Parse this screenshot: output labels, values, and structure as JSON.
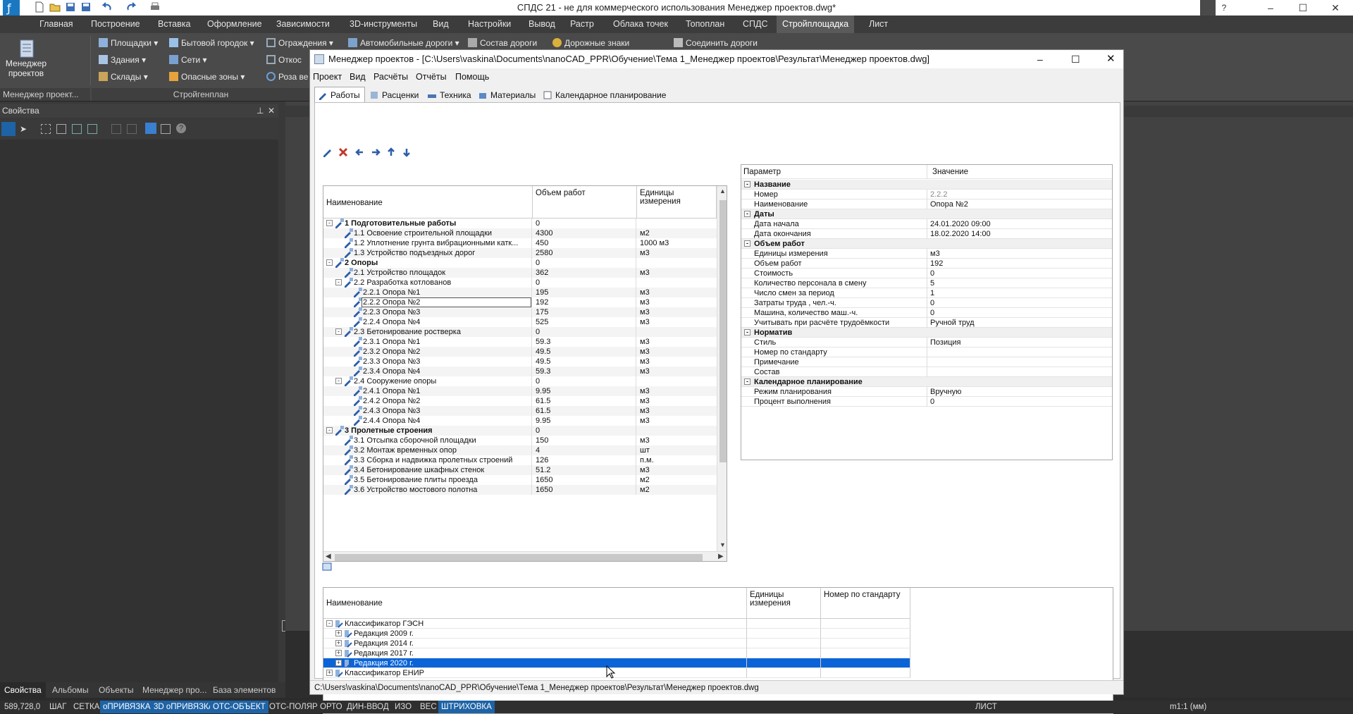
{
  "app": {
    "title": "СПДС 21 - не для коммерческого использования Менеджер проектов.dwg*"
  },
  "menu_tabs": [
    "Главная",
    "Построение",
    "Вставка",
    "Оформление",
    "Зависимости",
    "3D-инструменты",
    "Вид",
    "Настройки",
    "Вывод",
    "Растр",
    "Облака точек",
    "Топоплан",
    "СПДС",
    "Стройплощадка",
    "Лист"
  ],
  "ribbon": {
    "big_button": [
      "Менеджер",
      "проектов"
    ],
    "items": [
      "Площадки",
      "Бытовой городок",
      "Ограждения",
      "Автомобильные дороги",
      "Состав дороги",
      "Дорожные знаки",
      "Соединить дороги",
      "Здания",
      "Сети",
      "Откос",
      "Склады",
      "Опасные зоны",
      "Роза ве"
    ],
    "group_labels": [
      "Менеджер проект...",
      "Стройгенплан"
    ]
  },
  "left_panel": {
    "title": "Свойства",
    "bottom_tabs": [
      "Свойства",
      "Альбомы",
      "Объекты",
      "Менеджер про...",
      "База элементов"
    ]
  },
  "dialog": {
    "title": "Менеджер проектов - [C:\\Users\\vaskina\\Documents\\nanoCAD_PPR\\Обучение\\Тема 1_Менеджер проектов\\Результат\\Менеджер проектов.dwg]",
    "menu": [
      "Проект",
      "Вид",
      "Расчёты",
      "Отчёты",
      "Помощь"
    ],
    "tabs": [
      "Работы",
      "Расценки",
      "Техника",
      "Материалы",
      "Календарное планирование"
    ],
    "works_columns": [
      "Наименование",
      "Объем работ",
      "Единицы измерения"
    ],
    "works": [
      {
        "level": 0,
        "exp": "-",
        "name": "1 Подготовительные работы",
        "qty": "0",
        "unit": "",
        "bold": true
      },
      {
        "level": 1,
        "exp": "",
        "name": "1.1 Освоение строительной площадки",
        "qty": "4300",
        "unit": "м2"
      },
      {
        "level": 1,
        "exp": "",
        "name": "1.2 Уплотнение грунта вибрационными катк...",
        "qty": "450",
        "unit": "1000 м3"
      },
      {
        "level": 1,
        "exp": "",
        "name": "1.3 Устройство подъездных дорог",
        "qty": "2580",
        "unit": "м3"
      },
      {
        "level": 0,
        "exp": "-",
        "name": "2 Опоры",
        "qty": "0",
        "unit": "",
        "bold": true
      },
      {
        "level": 1,
        "exp": "",
        "name": "2.1 Устройство площадок",
        "qty": "362",
        "unit": "м3"
      },
      {
        "level": 1,
        "exp": "-",
        "name": "2.2 Разработка котлованов",
        "qty": "0",
        "unit": ""
      },
      {
        "level": 2,
        "exp": "",
        "name": "2.2.1 Опора №1",
        "qty": "195",
        "unit": "м3"
      },
      {
        "level": 2,
        "exp": "",
        "name": "2.2.2 Опора №2",
        "qty": "192",
        "unit": "м3",
        "selected": true
      },
      {
        "level": 2,
        "exp": "",
        "name": "2.2.3 Опора №3",
        "qty": "175",
        "unit": "м3"
      },
      {
        "level": 2,
        "exp": "",
        "name": "2.2.4 Опора №4",
        "qty": "525",
        "unit": "м3"
      },
      {
        "level": 1,
        "exp": "-",
        "name": "2.3 Бетонирование ростверка",
        "qty": "0",
        "unit": ""
      },
      {
        "level": 2,
        "exp": "",
        "name": "2.3.1 Опора №1",
        "qty": "59.3",
        "unit": "м3"
      },
      {
        "level": 2,
        "exp": "",
        "name": "2.3.2 Опора №2",
        "qty": "49.5",
        "unit": "м3"
      },
      {
        "level": 2,
        "exp": "",
        "name": "2.3.3 Опора №3",
        "qty": "49.5",
        "unit": "м3"
      },
      {
        "level": 2,
        "exp": "",
        "name": "2.3.4 Опора №4",
        "qty": "59.3",
        "unit": "м3"
      },
      {
        "level": 1,
        "exp": "-",
        "name": "2.4 Сооружение опоры",
        "qty": "0",
        "unit": ""
      },
      {
        "level": 2,
        "exp": "",
        "name": "2.4.1 Опора №1",
        "qty": "9.95",
        "unit": "м3"
      },
      {
        "level": 2,
        "exp": "",
        "name": "2.4.2 Опора №2",
        "qty": "61.5",
        "unit": "м3"
      },
      {
        "level": 2,
        "exp": "",
        "name": "2.4.3 Опора №3",
        "qty": "61.5",
        "unit": "м3"
      },
      {
        "level": 2,
        "exp": "",
        "name": "2.4.4 Опора №4",
        "qty": "9.95",
        "unit": "м3"
      },
      {
        "level": 0,
        "exp": "-",
        "name": "3 Пролетные строения",
        "qty": "0",
        "unit": "",
        "bold": true
      },
      {
        "level": 1,
        "exp": "",
        "name": "3.1 Отсыпка сборочной площадки",
        "qty": "150",
        "unit": "м3"
      },
      {
        "level": 1,
        "exp": "",
        "name": "3.2 Монтаж временных опор",
        "qty": "4",
        "unit": "шт"
      },
      {
        "level": 1,
        "exp": "",
        "name": "3.3 Сборка и надвижка пролетных строений",
        "qty": "126",
        "unit": "п.м."
      },
      {
        "level": 1,
        "exp": "",
        "name": "3.4 Бетонирование шкафных стенок",
        "qty": "51.2",
        "unit": "м3"
      },
      {
        "level": 1,
        "exp": "",
        "name": "3.5 Бетонирование плиты проезда",
        "qty": "1650",
        "unit": "м2"
      },
      {
        "level": 1,
        "exp": "",
        "name": "3.6 Устройство мостового полотна",
        "qty": "1650",
        "unit": "м2"
      }
    ],
    "props_columns": [
      "Параметр",
      "Значение"
    ],
    "props": [
      {
        "cat": true,
        "name": "Название"
      },
      {
        "name": "Номер",
        "value": "2.2.2",
        "grey": true
      },
      {
        "name": "Наименование",
        "value": "Опора №2"
      },
      {
        "cat": true,
        "name": "Даты"
      },
      {
        "name": "Дата начала",
        "value": "24.01.2020 09:00"
      },
      {
        "name": "Дата окончания",
        "value": "18.02.2020 14:00"
      },
      {
        "cat": true,
        "name": "Объем работ"
      },
      {
        "name": "Единицы измерения",
        "value": "м3"
      },
      {
        "name": "Объем работ",
        "value": "192"
      },
      {
        "name": "Стоимость",
        "value": "0"
      },
      {
        "name": "Количество персонала в смену",
        "value": "5"
      },
      {
        "name": "Число смен за период",
        "value": "1"
      },
      {
        "name": "Затраты труда , чел.-ч.",
        "value": "0"
      },
      {
        "name": "Машина, количество маш.-ч.",
        "value": "0"
      },
      {
        "name": "Учитывать при расчёте трудоёмкости",
        "value": "Ручной труд"
      },
      {
        "cat": true,
        "name": "Норматив"
      },
      {
        "name": "Стиль",
        "value": "Позиция"
      },
      {
        "name": "Номер по стандарту",
        "value": ""
      },
      {
        "name": "Примечание",
        "value": ""
      },
      {
        "name": "Состав",
        "value": ""
      },
      {
        "cat": true,
        "name": "Календарное планирование"
      },
      {
        "name": "Режим планирования",
        "value": "Вручную"
      },
      {
        "name": "Процент выполнения",
        "value": "0"
      }
    ],
    "classifier_columns": [
      "Наименование",
      "Единицы измерения",
      "Номер по стандарту"
    ],
    "classifier": [
      {
        "level": 0,
        "exp": "-",
        "name": "Классификатор ГЭСН"
      },
      {
        "level": 1,
        "exp": "+",
        "name": "Редакция 2009 г."
      },
      {
        "level": 1,
        "exp": "+",
        "name": "Редакция 2014 г."
      },
      {
        "level": 1,
        "exp": "+",
        "name": "Редакция 2017 г."
      },
      {
        "level": 1,
        "exp": "+",
        "name": "Редакция 2020 г.",
        "selected": true
      },
      {
        "level": 0,
        "exp": "+",
        "name": "Классификатор ЕНИР"
      }
    ],
    "status_path": "C:\\Users\\vaskina\\Documents\\nanoCAD_PPR\\Обучение\\Тема 1_Менеджер проектов\\Результат\\Менеджер проектов.dwg"
  },
  "status_bar": {
    "coords": "589,728,0",
    "toggles": [
      "ШАГ",
      "СЕТКА",
      "оПРИВЯЗКА",
      "3D оПРИВЯЗКА",
      "ОТС-ОБЪЕКТ",
      "ОТС-ПОЛЯР",
      "ОРТО",
      "ДИН-ВВОД",
      "ИЗО",
      "ВЕС",
      "ШТРИХОВКА"
    ],
    "toggles_on": [
      "оПРИВЯЗКА",
      "3D оПРИВЯЗКА",
      "ОТС-ОБЪЕКТ",
      "ШТРИХОВКА"
    ],
    "layout": "ЛИСТ",
    "scale": "m1:1 (мм)"
  },
  "colors": {
    "selection": "#0a64d8",
    "status_on": "#1e63a5",
    "ribbon": "#4a4a4a"
  }
}
